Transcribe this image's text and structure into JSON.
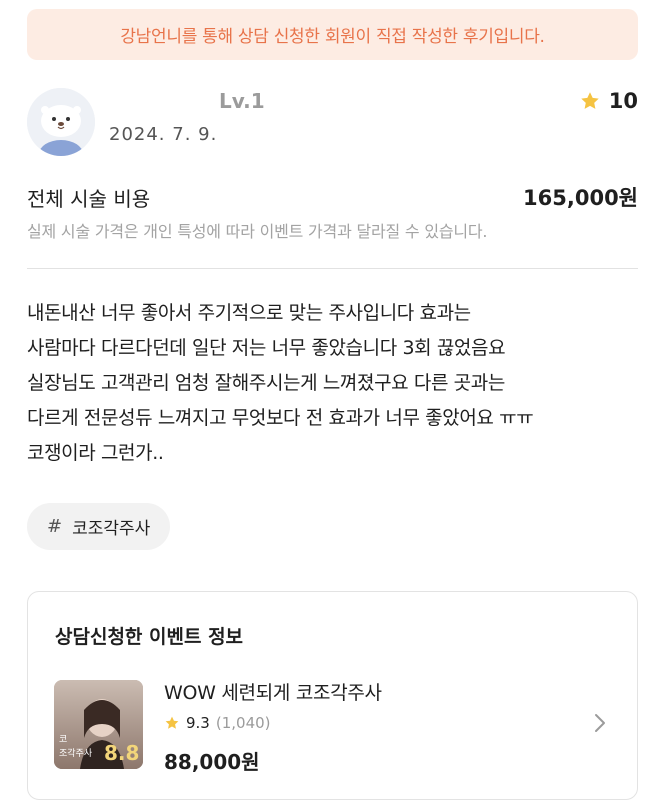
{
  "notice": {
    "text": "강남언니를 통해 상담 신청한 회원이 직접 작성한 후기입니다."
  },
  "review": {
    "level": "Lv.1",
    "date": "2024. 7. 9.",
    "rating": "10",
    "cost_label": "전체 시술 비용",
    "cost_value": "165,000원",
    "cost_note": "실제 시술 가격은 개인 특성에 따라 이벤트 가격과 달라질 수 있습니다.",
    "body_lines": [
      "내돈내산 너무 좋아서 주기적으로 맞는 주사입니다 효과는",
      "사람마다 다르다던데 일단 저는 너무 좋았습니다 3회 끊었음요",
      "실장님도 고객관리 엄청 잘해주시는게 느껴졌구요 다른 곳과는",
      "다르게 전문성듀 느껴지고 무엇보다 전 효과가 너무 좋았어요 ㅠㅠ",
      "코쟁이라 그런가.."
    ],
    "tag_hash": "#",
    "tag": "코조각주사"
  },
  "event": {
    "section_title": "상담신청한 이벤트 정보",
    "name": "WOW 세련되게 코조각주사",
    "score": "9.3",
    "review_count": "(1,040)",
    "price": "88,000원",
    "thumb_line1": "코",
    "thumb_line2": "조각주사",
    "thumb_price": "8.8"
  },
  "colors": {
    "notice_bg": "#fdece3",
    "notice_text": "#e8734a",
    "star": "#f5c342",
    "muted": "#a3a3a3"
  },
  "icons": [
    "profile-avatar",
    "star-icon",
    "chevron-right-icon"
  ]
}
